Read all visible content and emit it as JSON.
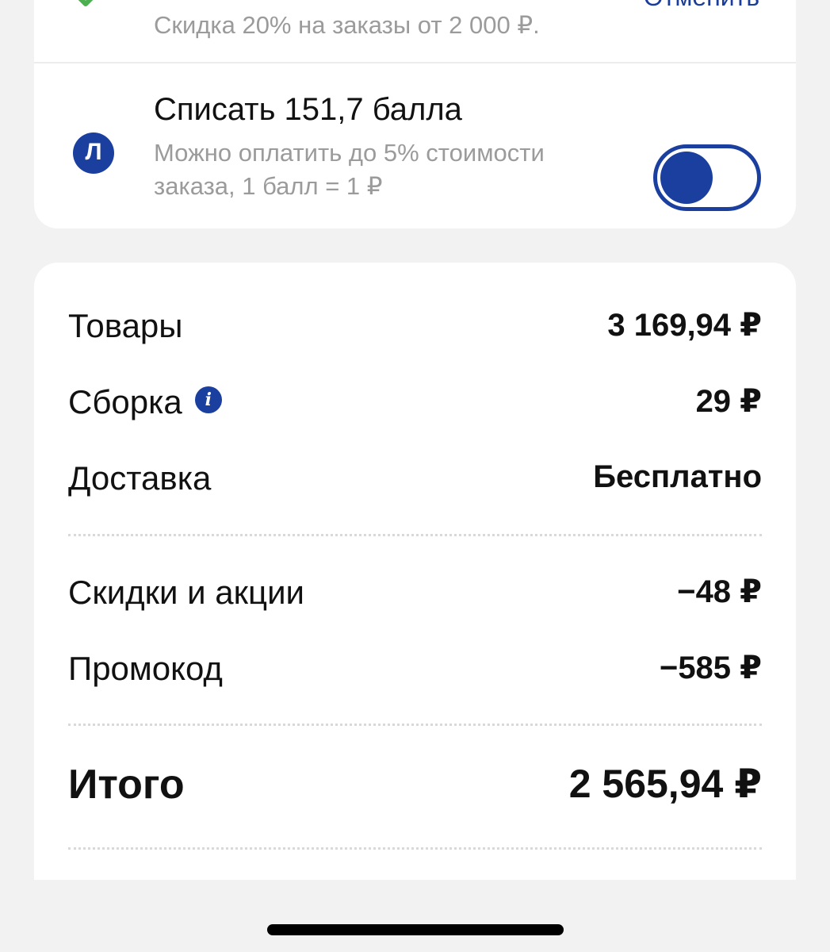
{
  "promo": {
    "subtitle": "Скидка 20%  на заказы от 2 000 ₽.",
    "cancel_label": "Отменить"
  },
  "points": {
    "badge_letter": "Л",
    "title": "Списать 151,7 балла",
    "description": "Можно оплатить до 5% стоимости заказа, 1 балл = 1 ₽",
    "toggle_on": true
  },
  "summary": {
    "goods_label": "Товары",
    "goods_value": "3 169,94 ₽",
    "assembly_label": "Сборка",
    "assembly_value": "29 ₽",
    "delivery_label": "Доставка",
    "delivery_value": "Бесплатно",
    "discounts_label": "Скидки и акции",
    "discounts_value": "−48 ₽",
    "promo_label": "Промокод",
    "promo_value": "−585 ₽",
    "total_label": "Итого",
    "total_value": "2 565,94 ₽"
  },
  "colors": {
    "accent": "#1b3f9e",
    "check": "#4caf50",
    "muted_text": "#9b9b9b"
  }
}
